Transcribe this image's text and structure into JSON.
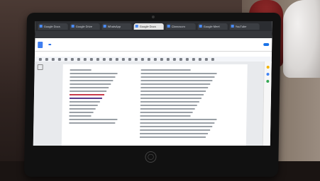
{
  "browser": {
    "tabs": [
      {
        "title": "Google Docs",
        "active": false
      },
      {
        "title": "Google Drive",
        "active": false
      },
      {
        "title": "WhatsApp",
        "active": false
      },
      {
        "title": "Google Docs",
        "active": true
      },
      {
        "title": "Classroom",
        "active": false
      },
      {
        "title": "Google Meet",
        "active": false
      },
      {
        "title": "YouTube",
        "active": false
      }
    ],
    "url": ""
  },
  "document": {
    "title": "",
    "badge": "",
    "share_label": "",
    "menu": [
      "",
      "",
      "",
      "",
      "",
      "",
      "",
      ""
    ],
    "left_lines": [],
    "right_lines": []
  },
  "colors": {
    "highlight_red": "#c83a4a",
    "highlight_purple": "#5a3a8a",
    "accent": "#1a73e8"
  },
  "icons": {
    "docs": "docs-icon",
    "outline": "outline-icon"
  }
}
